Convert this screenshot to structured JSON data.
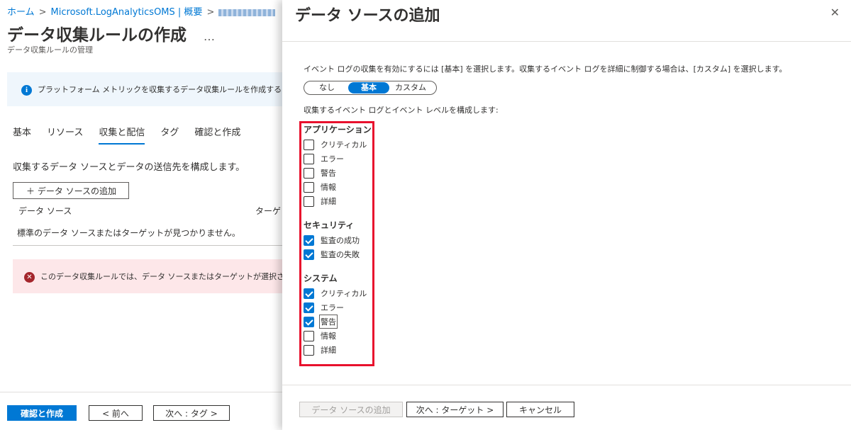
{
  "breadcrumb": {
    "home": "ホーム",
    "workspace": "Microsoft.LogAnalyticsOMS | 概要",
    "sep": ">"
  },
  "page": {
    "title": "データ収集ルールの作成",
    "more": "…",
    "subtitle": "データ収集ルールの管理"
  },
  "info_bar": {
    "icon": "info-icon",
    "text": "プラットフォーム メトリックを収集するデータ収集ルールを作成するには、こ"
  },
  "tabs": [
    {
      "label": "基本"
    },
    {
      "label": "リソース"
    },
    {
      "label": "収集と配信",
      "active": true
    },
    {
      "label": "タグ"
    },
    {
      "label": "確認と作成"
    }
  ],
  "collect": {
    "description": "収集するデータ ソースとデータの送信先を構成します。",
    "add_button": "＋ データ ソースの追加",
    "col_datasource": "データ ソース",
    "col_target": "ターゲット",
    "empty_text": "標準のデータ ソースまたはターゲットが見つかりません。"
  },
  "error_bar": {
    "icon": "error-icon",
    "text": "このデータ収集ルールでは、データ ソースまたはターゲットが選択されて"
  },
  "footer": {
    "review_create": "確認と作成",
    "prev": "< 前へ",
    "next_tag": "次へ : タグ >"
  },
  "panel": {
    "title": "データ ソースの追加",
    "close": "✕",
    "description": "イベント ログの収集を有効にするには [基本] を選択します。収集するイベント ログを詳細に制御する場合は、[カスタム] を選択します。",
    "options": [
      {
        "label": "なし"
      },
      {
        "label": "基本",
        "selected": true
      },
      {
        "label": "カスタム"
      }
    ],
    "config_label": "収集するイベント ログとイベント レベルを構成します:",
    "groups": {
      "application": {
        "title": "アプリケーション",
        "items": [
          {
            "label": "クリティカル",
            "checked": false
          },
          {
            "label": "エラー",
            "checked": false
          },
          {
            "label": "警告",
            "checked": false
          },
          {
            "label": "情報",
            "checked": false
          },
          {
            "label": "詳細",
            "checked": false
          }
        ]
      },
      "security": {
        "title": "セキュリティ",
        "items": [
          {
            "label": "監査の成功",
            "checked": true
          },
          {
            "label": "監査の失敗",
            "checked": true
          }
        ]
      },
      "system": {
        "title": "システム",
        "items": [
          {
            "label": "クリティカル",
            "checked": true
          },
          {
            "label": "エラー",
            "checked": true
          },
          {
            "label": "警告",
            "checked": true
          },
          {
            "label": "情報",
            "checked": false
          },
          {
            "label": "詳細",
            "checked": false
          }
        ]
      }
    },
    "buttons": {
      "add": "データ ソースの追加",
      "next_target": "次へ : ターゲット >",
      "cancel": "キャンセル"
    }
  },
  "colors": {
    "accent": "#0078d4",
    "highlight_box": "#e8112d",
    "info_bg": "#eff6fc",
    "error_bg": "#fde7e9"
  }
}
